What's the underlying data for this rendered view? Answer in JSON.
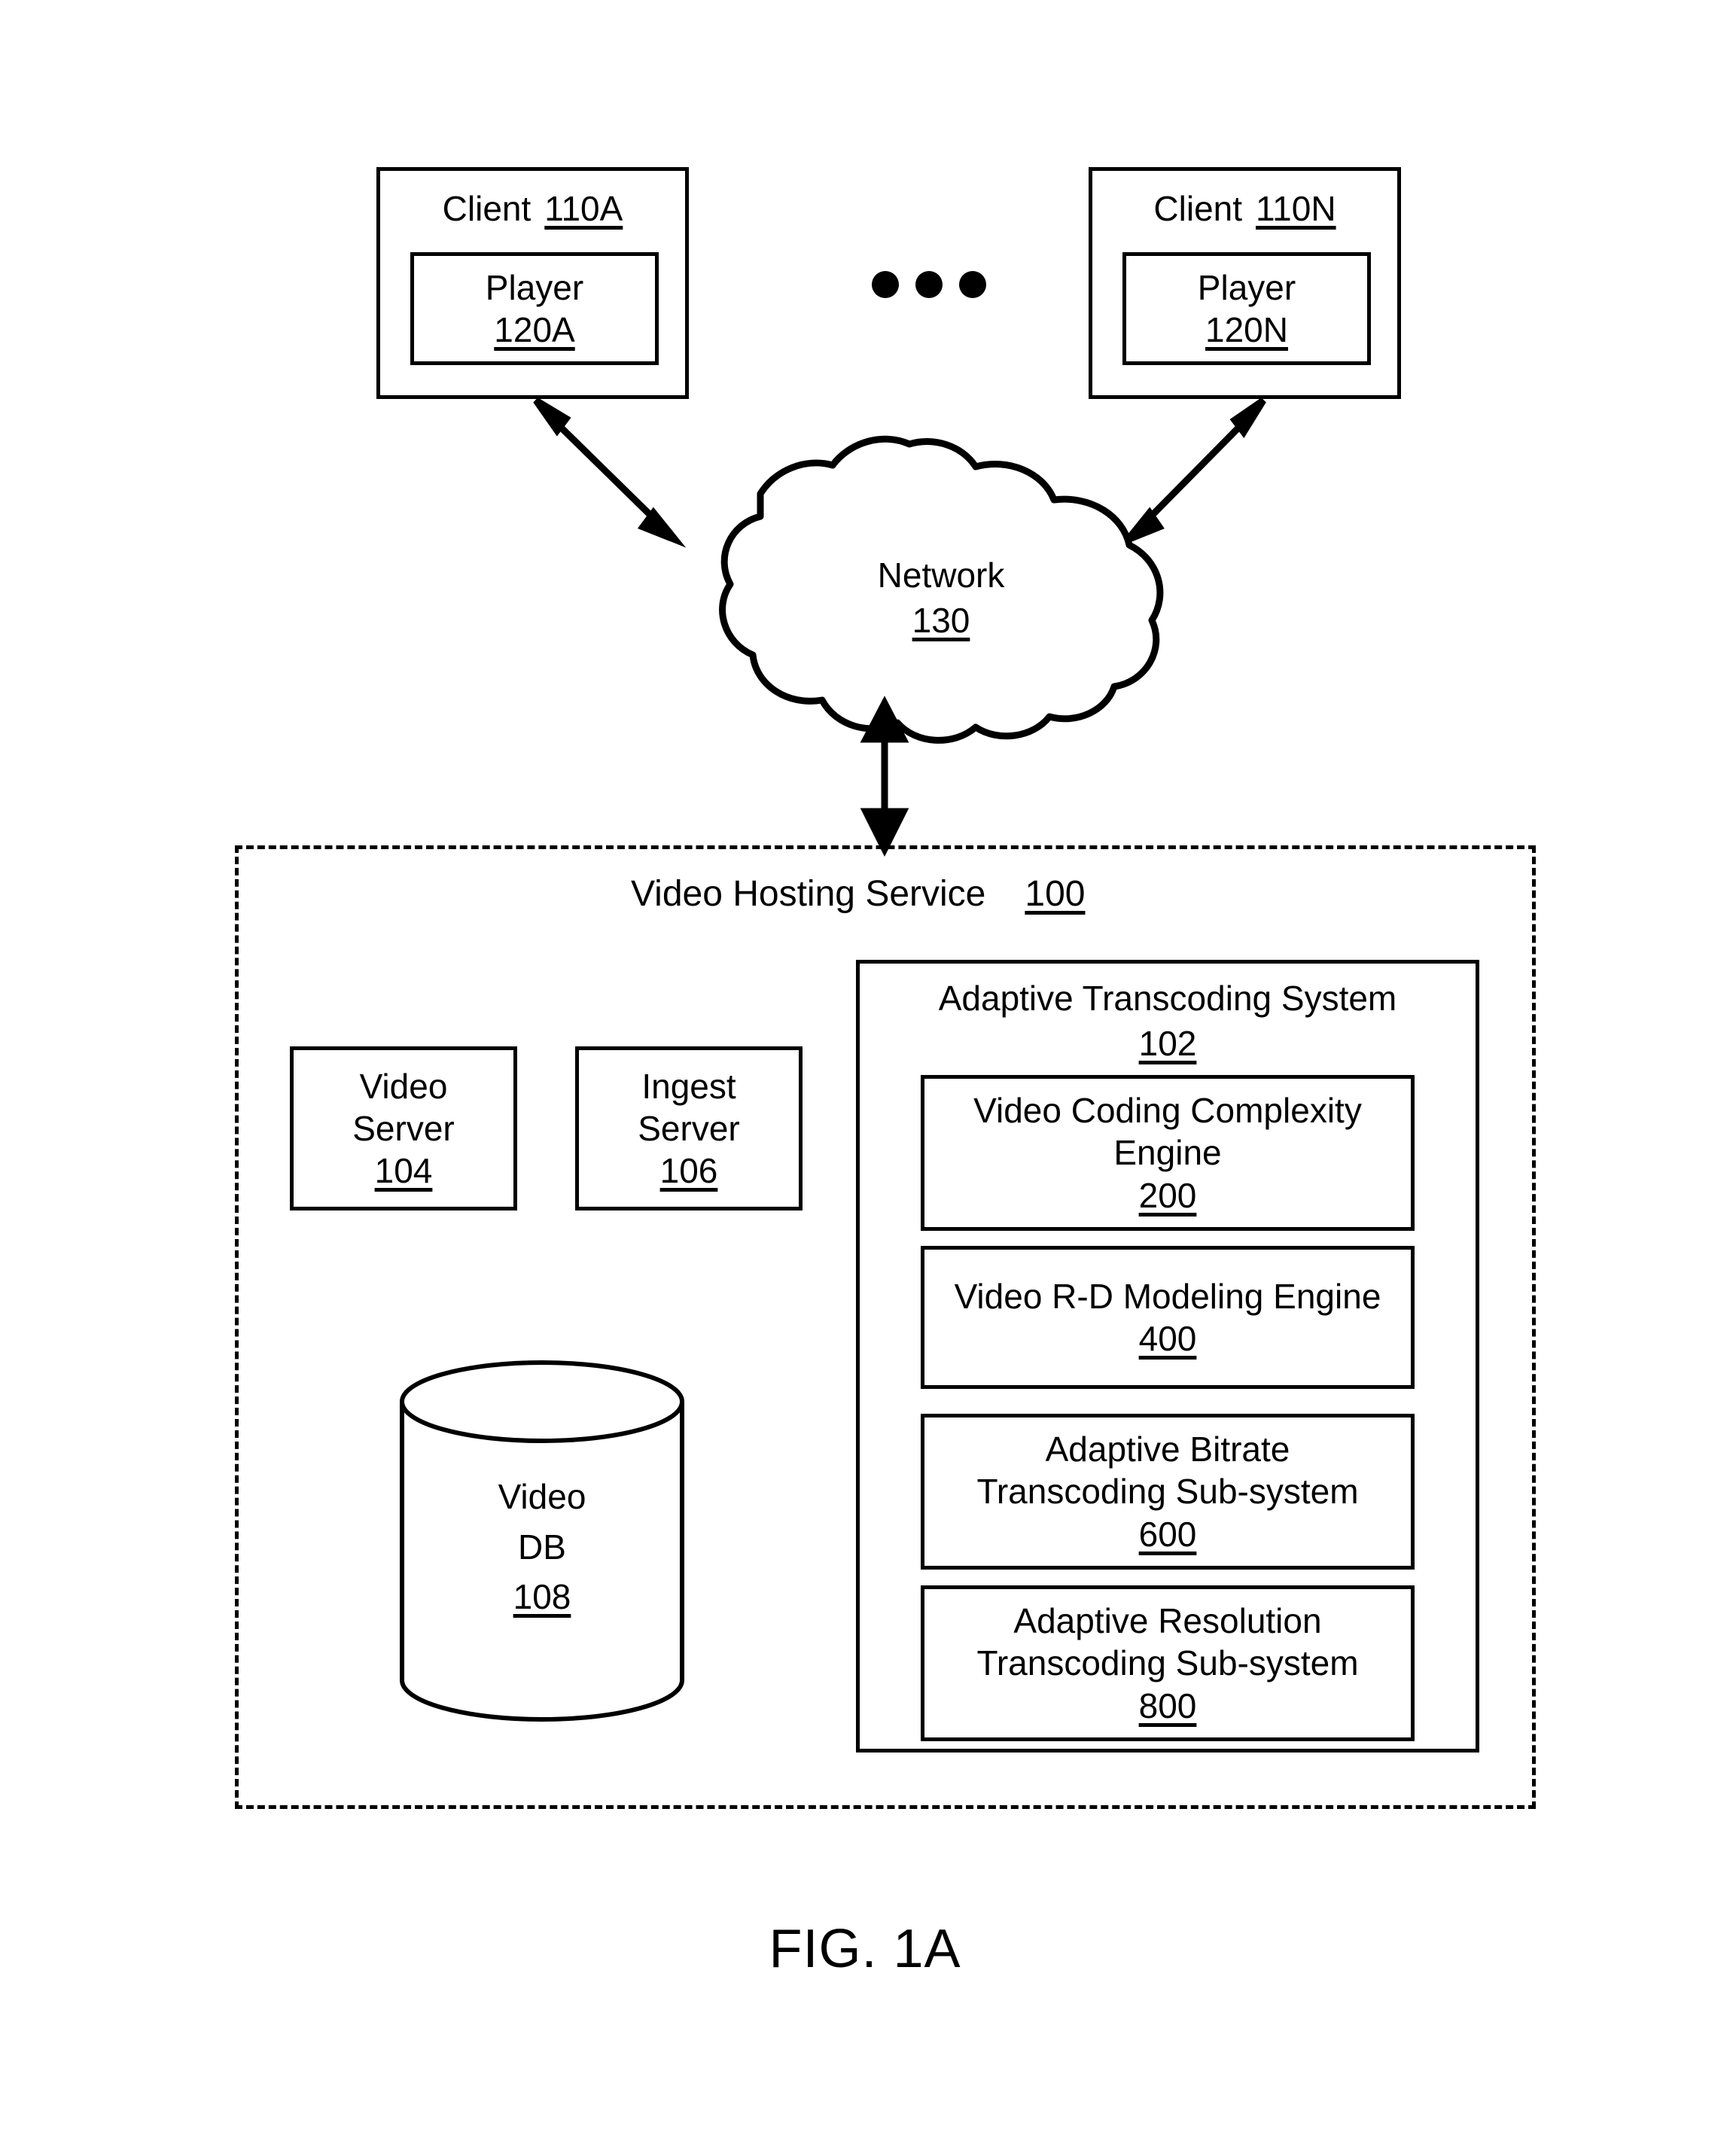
{
  "figure": {
    "caption": "FIG. 1A"
  },
  "clients": [
    {
      "title": "Client",
      "ref": "110A",
      "player": {
        "name": "Player",
        "ref": "120A"
      }
    },
    {
      "title": "Client",
      "ref": "110N",
      "player": {
        "name": "Player",
        "ref": "120N"
      }
    }
  ],
  "ellipsis": {
    "glyph": "•••",
    "count": 3
  },
  "network": {
    "label": "Network",
    "ref": "130"
  },
  "video_hosting_service": {
    "title": "Video Hosting Service",
    "ref": "100",
    "video_server": {
      "line1": "Video",
      "line2": "Server",
      "ref": "104"
    },
    "ingest_server": {
      "line1": "Ingest",
      "line2": "Server",
      "ref": "106"
    },
    "video_db": {
      "line1": "Video",
      "line2": "DB",
      "ref": "108"
    },
    "adaptive_transcoding_system": {
      "title": "Adaptive Transcoding System",
      "ref": "102",
      "modules": [
        {
          "line1": "Video Coding Complexity",
          "line2": "Engine",
          "ref": "200"
        },
        {
          "line1": "Video R-D Modeling Engine",
          "line2": "",
          "ref": "400"
        },
        {
          "line1": "Adaptive Bitrate",
          "line2": "Transcoding Sub-system",
          "ref": "600"
        },
        {
          "line1": "Adaptive Resolution",
          "line2": "Transcoding Sub-system",
          "ref": "800"
        }
      ]
    }
  },
  "colors": {
    "stroke": "#000000",
    "background": "#ffffff"
  }
}
